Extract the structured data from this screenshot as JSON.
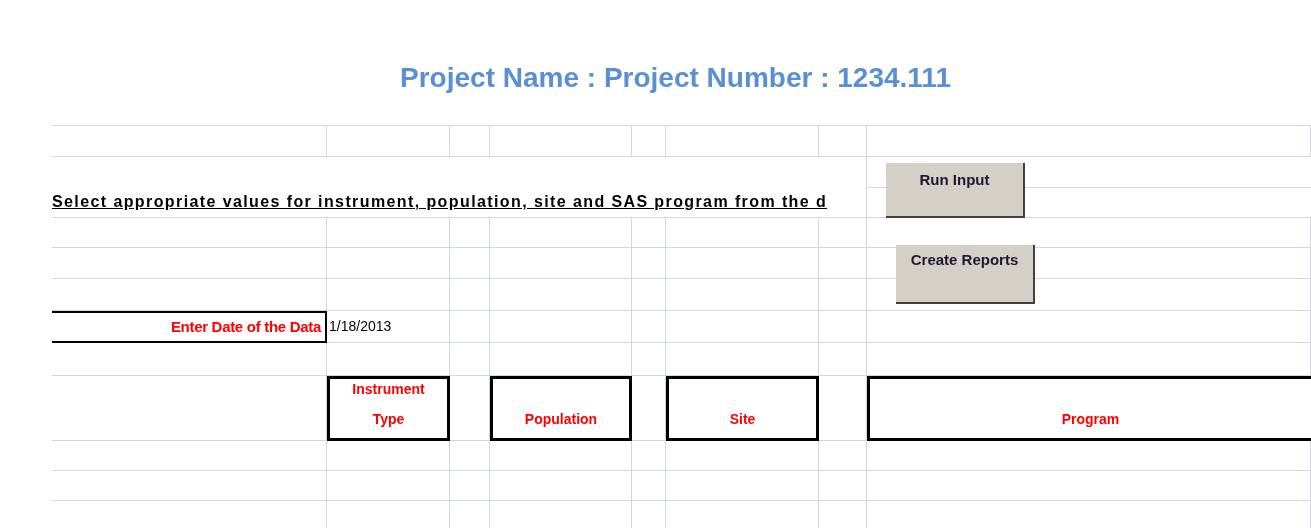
{
  "title": "Project Name : Project Number : 1234.111",
  "instruction": "Select appropriate values for instrument, population, site and SAS program from the d",
  "buttons": [
    {
      "label": "Run Input"
    },
    {
      "label": "Create Reports"
    }
  ],
  "date_field": {
    "label": "Enter Date of the Data",
    "value": "1/18/2013"
  },
  "headers": [
    "Instrument Type",
    "Population",
    "Site",
    "Program"
  ]
}
